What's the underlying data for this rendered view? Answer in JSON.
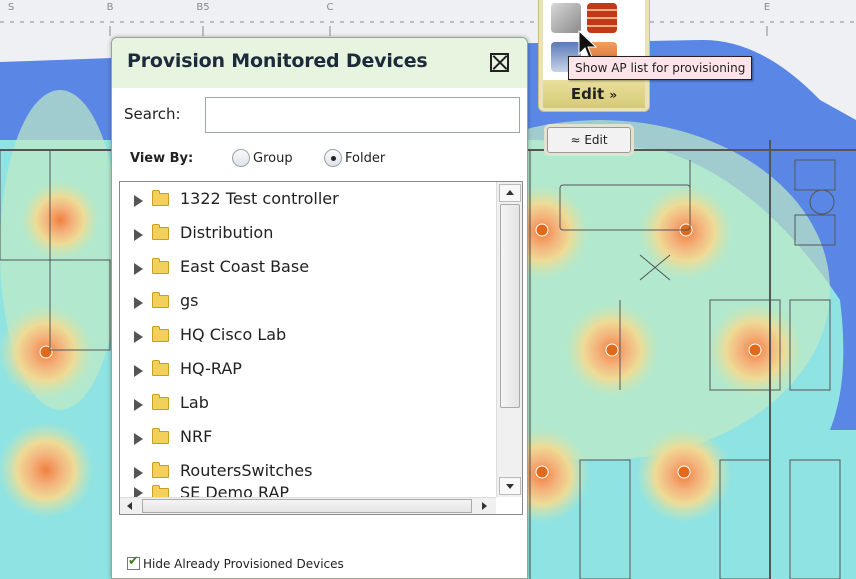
{
  "map": {
    "column_markers": [
      "S",
      "B",
      "B5",
      "C",
      "E"
    ]
  },
  "toolbar": {
    "edit_label": "Edit",
    "edit_button_label": "Edit",
    "tooltip": "Show AP list for provisioning"
  },
  "panel": {
    "title": "Provision Monitored Devices",
    "search_label": "Search:",
    "search_value": "",
    "view_by_label": "View By:",
    "view_options": [
      {
        "label": "Group",
        "selected": false
      },
      {
        "label": "Folder",
        "selected": true
      }
    ],
    "folders": [
      "1322 Test controller",
      "Distribution",
      "East Coast Base",
      "gs",
      "HQ Cisco Lab",
      "HQ-RAP",
      "Lab",
      "NRF",
      "RoutersSwitches",
      "SE Demo RAP"
    ],
    "hide_provisioned_label": "Hide Already Provisioned Devices",
    "hide_provisioned_checked": true
  },
  "colors": {
    "heat_blue": "#5a86e6",
    "heat_cyan": "#8fe3e3",
    "heat_yellow": "#e8e8a0",
    "heat_orange": "#f0b070",
    "panel_header": "#e6f4e0",
    "tooltip_bg": "#fde4ea",
    "toolbar_bg": "#e9e3b9"
  }
}
